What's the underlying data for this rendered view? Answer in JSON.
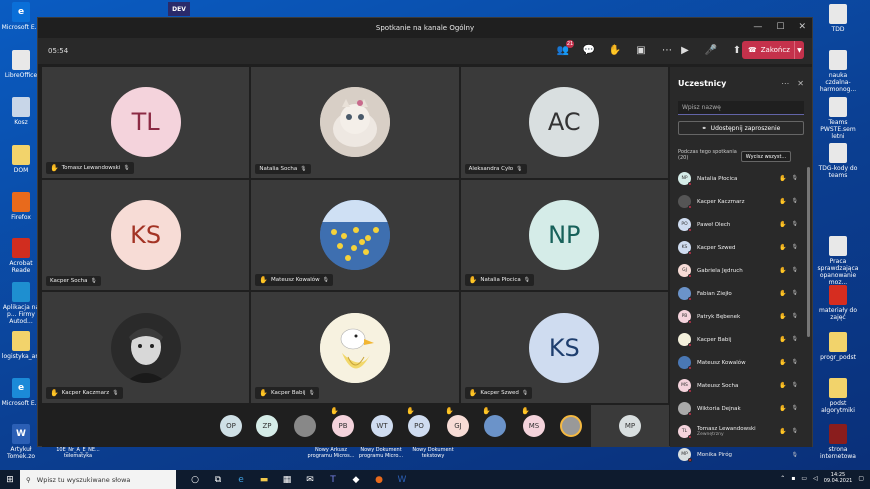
{
  "desktop": {
    "left_icons": [
      {
        "label": "Microsoft E...",
        "color": "#0a6fd8",
        "glyph": "e"
      },
      {
        "label": "LibreOffice",
        "color": "#e8e8e8",
        "glyph": ""
      },
      {
        "label": "Kosz",
        "color": "#c8d6e8",
        "glyph": ""
      },
      {
        "label": "DOM",
        "color": "#f2d36b",
        "glyph": ""
      },
      {
        "label": "Firefox",
        "color": "#e86a1c",
        "glyph": ""
      },
      {
        "label": "Acrobat Reade",
        "color": "#d12d1f",
        "glyph": ""
      },
      {
        "label": "Aplikacja na p... Firmy Autod...",
        "color": "#1e8fd0",
        "glyph": ""
      },
      {
        "label": "logistyka_art",
        "color": "#f2d36b",
        "glyph": ""
      },
      {
        "label": "Microsoft E...",
        "color": "#1b8ad8",
        "glyph": "e"
      },
      {
        "label": "Artykuł Tomek.zo",
        "color": "#2b5fb5",
        "glyph": "W"
      }
    ],
    "right_icons": [
      {
        "label": "TDD",
        "color": "#e8e8e8"
      },
      {
        "label": "nauka czdalna-harmonog...",
        "color": "#e8e8e8"
      },
      {
        "label": "Teams PWSTE.sem letni",
        "color": "#e8e8e8"
      },
      {
        "label": "TDG-kody do teams",
        "color": "#e8e8e8"
      },
      {
        "label": "Praca sprawdzająca opanowanie moz...",
        "color": "#e8e8e8"
      },
      {
        "label": "materiały do zajęć",
        "color": "#d62d20"
      },
      {
        "label": "progr_podst",
        "color": "#f2d36b"
      },
      {
        "label": "podst algorytmiki",
        "color": "#f2d36b"
      },
      {
        "label": "strona internetowa",
        "color": "#8a1d1d"
      }
    ],
    "top_labels": [
      "DEV"
    ],
    "bottom_labels": [
      "10E_Nr_A_E_NE... telematyka",
      "Nowy Arkusz programu Micros...",
      "Nowy Dokument programu Micro...",
      "Nowy Dokument tekstowy"
    ]
  },
  "window": {
    "title": "Spotkanie na kanale Ogólny",
    "controls": [
      "—",
      "☐",
      "✕"
    ]
  },
  "meeting": {
    "timer": "05:54",
    "participants_count": "21",
    "end_label": "Zakończ",
    "tiles": [
      {
        "initials": "TL",
        "name": "Tomasz Lewandowski",
        "bg": "#f4d3dc",
        "fg": "#8b2a44",
        "hand": true,
        "photo": false
      },
      {
        "initials": "",
        "name": "Natalia Socha",
        "bg": "#cfc4bb",
        "fg": "#333",
        "hand": false,
        "photo": true,
        "photo_kind": "kitten"
      },
      {
        "initials": "AC",
        "name": "Aleksandra Cyło",
        "bg": "#d9dfe0",
        "fg": "#333",
        "hand": false,
        "photo": false
      },
      {
        "initials": "KS",
        "name": "Kacper Socha",
        "bg": "#f7dcd6",
        "fg": "#a33324",
        "hand": false,
        "photo": false
      },
      {
        "initials": "",
        "name": "Mateusz Kowalów",
        "bg": "#4a78b5",
        "fg": "#333",
        "hand": true,
        "photo": true,
        "photo_kind": "ducks"
      },
      {
        "initials": "NP",
        "name": "Natalia Płocica",
        "bg": "#d5ece8",
        "fg": "#17615a",
        "hand": true,
        "photo": false
      },
      {
        "initials": "",
        "name": "Kacper Kaczmarz",
        "bg": "#333",
        "fg": "#fff",
        "hand": true,
        "photo": true,
        "photo_kind": "person"
      },
      {
        "initials": "",
        "name": "Kacper Babij",
        "bg": "#f4f0dc",
        "fg": "#333",
        "hand": true,
        "photo": true,
        "photo_kind": "goose"
      },
      {
        "initials": "KS",
        "name": "Kacper Szwed",
        "bg": "#cfdcf0",
        "fg": "#1e3e6e",
        "hand": true,
        "photo": false
      }
    ],
    "strip": [
      {
        "initials": "OP",
        "bg": "#cfe0e6",
        "hand": false
      },
      {
        "initials": "ZP",
        "bg": "#d5ece8",
        "hand": false
      },
      {
        "initials": "",
        "bg": "#888",
        "hand": false
      },
      {
        "initials": "PB",
        "bg": "#f4d3dc",
        "hand": true
      },
      {
        "initials": "WT",
        "bg": "#cfdcf0",
        "hand": false
      },
      {
        "initials": "PO",
        "bg": "#cfdcf0",
        "hand": true
      },
      {
        "initials": "GJ",
        "bg": "#f7dcd6",
        "hand": true
      },
      {
        "initials": "",
        "bg": "#6b93c9",
        "hand": true
      },
      {
        "initials": "MS",
        "bg": "#f4d3dc",
        "hand": true
      },
      {
        "initials": "",
        "bg": "#999",
        "hand": false
      }
    ],
    "self_initials": "MP"
  },
  "panel": {
    "title": "Uczestnicy",
    "search_placeholder": "Wpisz nazwę",
    "share_label": "Udostępnij zaproszenie",
    "section_label": "Podczas tego spotkania",
    "section_count": "(20)",
    "mute_all_label": "Wycisz wszyst...",
    "participants": [
      {
        "name": "Natalia Płocica",
        "initials": "NP",
        "bg": "#d5ece8",
        "hand": true,
        "sub": ""
      },
      {
        "name": "Kacper Kaczmarz",
        "initials": "",
        "bg": "#555",
        "hand": true,
        "sub": ""
      },
      {
        "name": "Paweł Olech",
        "initials": "PO",
        "bg": "#cfdcf0",
        "hand": true,
        "sub": ""
      },
      {
        "name": "Kacper Szwed",
        "initials": "KS",
        "bg": "#cfdcf0",
        "hand": true,
        "sub": ""
      },
      {
        "name": "Gabriela Jędruch",
        "initials": "GJ",
        "bg": "#f7dcd6",
        "hand": true,
        "sub": ""
      },
      {
        "name": "Fabian Ziejło",
        "initials": "",
        "bg": "#6b93c9",
        "hand": true,
        "sub": ""
      },
      {
        "name": "Patryk Bębenek",
        "initials": "PB",
        "bg": "#f4d3dc",
        "hand": true,
        "sub": ""
      },
      {
        "name": "Kacper Babij",
        "initials": "",
        "bg": "#f4f0dc",
        "hand": true,
        "sub": ""
      },
      {
        "name": "Mateusz Kowalów",
        "initials": "",
        "bg": "#4a78b5",
        "hand": true,
        "sub": ""
      },
      {
        "name": "Mateusz Socha",
        "initials": "MS",
        "bg": "#f4d3dc",
        "hand": true,
        "sub": ""
      },
      {
        "name": "Wiktoria Dejnak",
        "initials": "",
        "bg": "#aaa",
        "hand": true,
        "sub": ""
      },
      {
        "name": "Tomasz Lewandowski",
        "initials": "TL",
        "bg": "#f4d3dc",
        "hand": true,
        "sub": "Zewnętrzny"
      },
      {
        "name": "Monika Piróg",
        "initials": "MP",
        "bg": "#d9dfe0",
        "hand": false,
        "sub": ""
      }
    ]
  },
  "taskbar": {
    "search_placeholder": "Wpisz tu wyszukiwane słowa",
    "time": "14:25",
    "date": "09.04.2021"
  }
}
